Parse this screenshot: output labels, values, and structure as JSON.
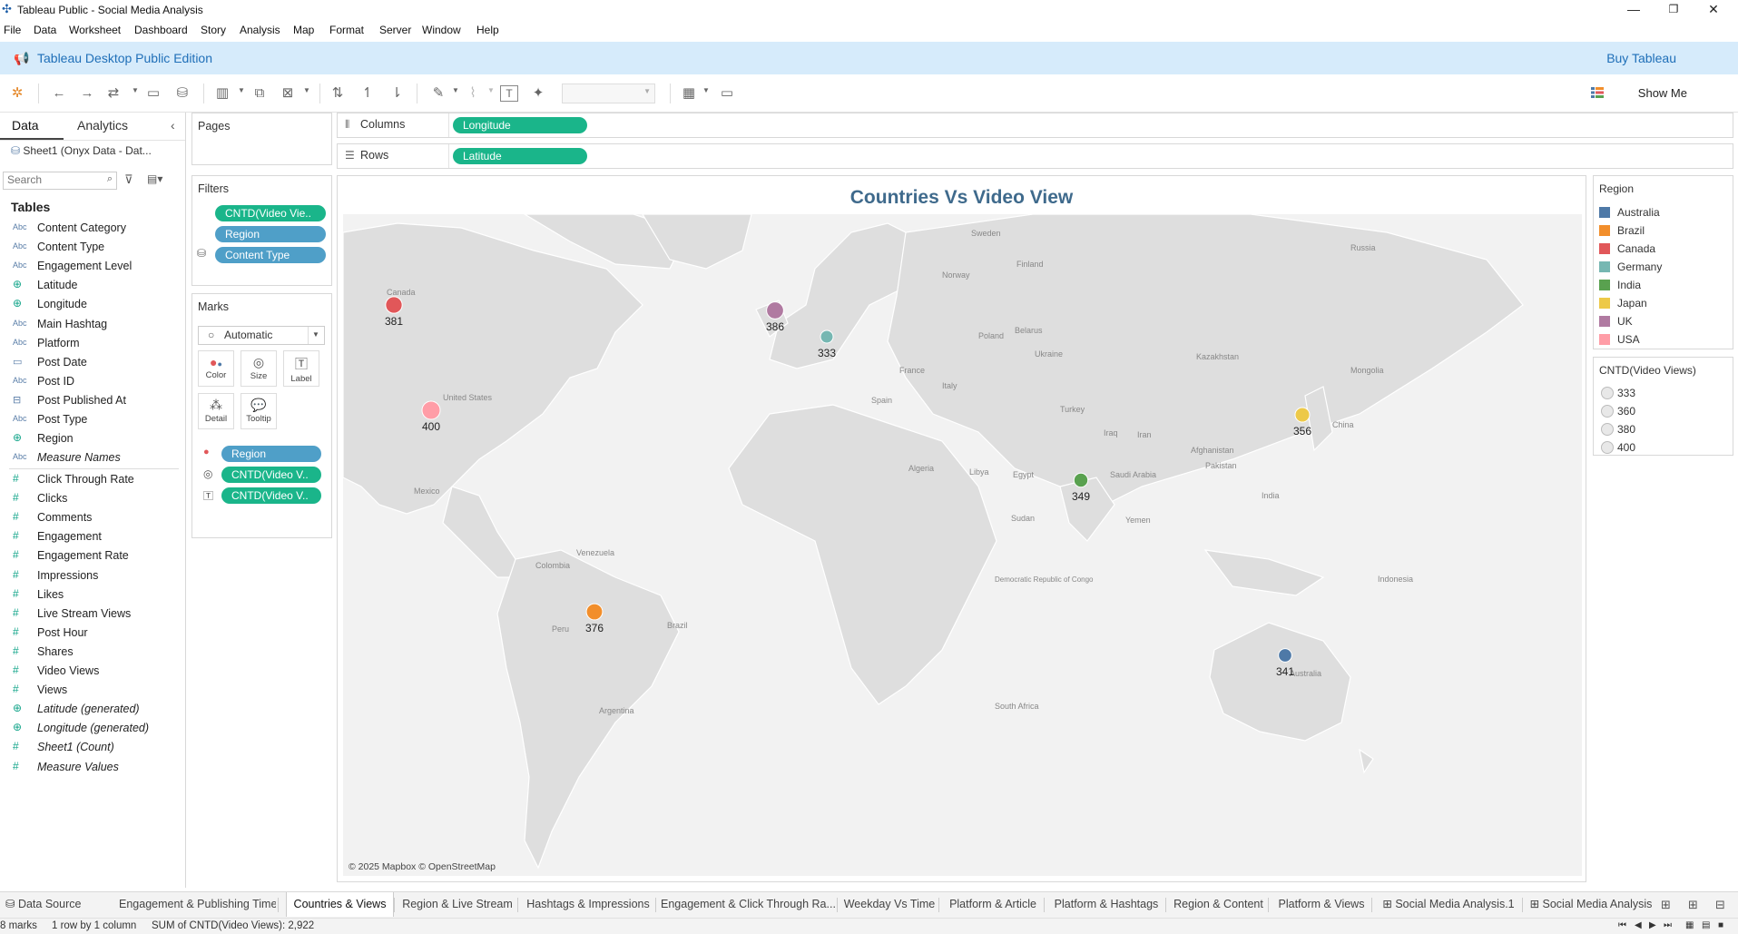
{
  "window": {
    "title": "Tableau Public - Social Media Analysis",
    "minimize": "—",
    "maximize": "❐",
    "close": "✕"
  },
  "menu": [
    "File",
    "Data",
    "Worksheet",
    "Dashboard",
    "Story",
    "Analysis",
    "Map",
    "Format",
    "Server",
    "Window",
    "Help"
  ],
  "edition": {
    "title": "Tableau Desktop Public Edition",
    "buy": "Buy Tableau"
  },
  "toolbar": {
    "show_me": "Show Me"
  },
  "left_pane": {
    "tab_data": "Data",
    "tab_analytics": "Analytics",
    "data_source": "Sheet1 (Onyx Data - Dat...",
    "search_placeholder": "Search",
    "tables_header": "Tables",
    "dimensions": [
      {
        "type": "abc",
        "name": "Content Category"
      },
      {
        "type": "abc",
        "name": "Content Type"
      },
      {
        "type": "abc",
        "name": "Engagement Level"
      },
      {
        "type": "geo",
        "name": "Latitude"
      },
      {
        "type": "geo",
        "name": "Longitude"
      },
      {
        "type": "abc",
        "name": "Main Hashtag"
      },
      {
        "type": "abc",
        "name": "Platform"
      },
      {
        "type": "date",
        "name": "Post Date"
      },
      {
        "type": "abc",
        "name": "Post ID"
      },
      {
        "type": "datetime",
        "name": "Post Published At"
      },
      {
        "type": "abc",
        "name": "Post Type"
      },
      {
        "type": "geo",
        "name": "Region"
      },
      {
        "type": "abc",
        "name": "Measure Names",
        "italic": true
      }
    ],
    "measures": [
      {
        "name": "Click Through Rate"
      },
      {
        "name": "Clicks"
      },
      {
        "name": "Comments"
      },
      {
        "name": "Engagement"
      },
      {
        "name": "Engagement Rate"
      },
      {
        "name": "Impressions"
      },
      {
        "name": "Likes"
      },
      {
        "name": "Live Stream Views"
      },
      {
        "name": "Post Hour"
      },
      {
        "name": "Shares"
      },
      {
        "name": "Video Views"
      },
      {
        "name": "Views"
      },
      {
        "name": "Latitude (generated)",
        "italic": true,
        "geo": true
      },
      {
        "name": "Longitude (generated)",
        "italic": true,
        "geo": true
      },
      {
        "name": "Sheet1 (Count)",
        "italic": true
      },
      {
        "name": "Measure Values",
        "italic": true
      }
    ]
  },
  "shelves": {
    "pages": "Pages",
    "columns_label": "Columns",
    "columns_pill": "Longitude",
    "rows_label": "Rows",
    "rows_pill": "Latitude"
  },
  "filters": {
    "title": "Filters",
    "pills": [
      "CNTD(Video Vie..",
      "Region",
      "Content Type"
    ]
  },
  "marks": {
    "title": "Marks",
    "type": "Automatic",
    "buttons": [
      "Color",
      "Size",
      "Label",
      "Detail",
      "Tooltip"
    ],
    "pills": [
      "Region",
      "CNTD(Video V..",
      "CNTD(Video V.."
    ]
  },
  "chart_data": {
    "type": "scatter",
    "title": "Countries Vs Video View",
    "measure": "CNTD(Video Views)",
    "points": [
      {
        "region": "Canada",
        "value": 381,
        "color": "#e15759"
      },
      {
        "region": "UK",
        "value": 386,
        "color": "#b07aa1"
      },
      {
        "region": "Germany",
        "value": 333,
        "color": "#76b7b2"
      },
      {
        "region": "USA",
        "value": 400,
        "color": "#ff9da7"
      },
      {
        "region": "Japan",
        "value": 356,
        "color": "#edc948"
      },
      {
        "region": "India",
        "value": 349,
        "color": "#59a14f"
      },
      {
        "region": "Brazil",
        "value": 376,
        "color": "#f28e2b"
      },
      {
        "region": "Australia",
        "value": 341,
        "color": "#4e79a7"
      }
    ]
  },
  "map_labels": [
    "Sweden",
    "Finland",
    "Russia",
    "Norway",
    "Canada",
    "Poland",
    "Belarus",
    "Ukraine",
    "Kazakhstan",
    "Mongolia",
    "France",
    "Italy",
    "Spain",
    "Turkey",
    "United States",
    "Iraq",
    "Iran",
    "China",
    "Afghanistan",
    "Pakistan",
    "Algeria",
    "Libya",
    "Egypt",
    "Saudi Arabia",
    "India",
    "Mexico",
    "Sudan",
    "Yemen",
    "Venezuela",
    "Colombia",
    "Democratic Republic of Congo",
    "Indonesia",
    "Brazil",
    "Peru",
    "Argentina",
    "South Africa",
    "Australia"
  ],
  "map_credit": "© 2025 Mapbox © OpenStreetMap",
  "legend_region": {
    "title": "Region",
    "items": [
      {
        "name": "Australia",
        "color": "#4e79a7"
      },
      {
        "name": "Brazil",
        "color": "#f28e2b"
      },
      {
        "name": "Canada",
        "color": "#e15759"
      },
      {
        "name": "Germany",
        "color": "#76b7b2"
      },
      {
        "name": "India",
        "color": "#59a14f"
      },
      {
        "name": "Japan",
        "color": "#edc948"
      },
      {
        "name": "UK",
        "color": "#b07aa1"
      },
      {
        "name": "USA",
        "color": "#ff9da7"
      }
    ]
  },
  "legend_size": {
    "title": "CNTD(Video Views)",
    "items": [
      "333",
      "360",
      "380",
      "400"
    ]
  },
  "tabs": {
    "data_source": "Data Source",
    "sheets": [
      "Engagement & Publishing Time",
      "Countries & Views",
      "Region & Live Stream",
      "Hashtags & Impressions",
      "Engagement & Click Through Ra...",
      "Weekday Vs Time",
      "Platform & Article",
      "Platform & Hashtags",
      "Region & Content",
      "Platform & Views",
      "Social Media Analysis.1",
      "Social Media Analysis"
    ],
    "active": "Countries & Views"
  },
  "status": {
    "marks": "8 marks",
    "rows": "1 row by 1 column",
    "sum": "SUM of CNTD(Video Views): 2,922"
  }
}
